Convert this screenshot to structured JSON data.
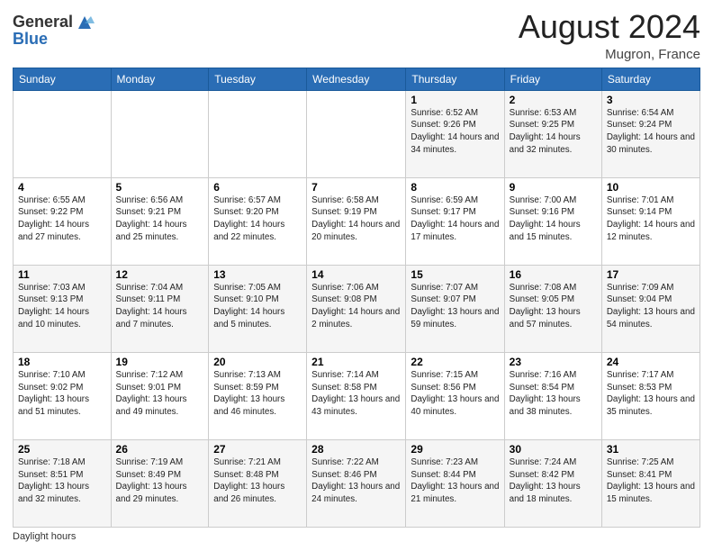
{
  "header": {
    "logo_general": "General",
    "logo_blue": "Blue",
    "month_year": "August 2024",
    "location": "Mugron, France"
  },
  "footer": {
    "daylight_label": "Daylight hours"
  },
  "days_of_week": [
    "Sunday",
    "Monday",
    "Tuesday",
    "Wednesday",
    "Thursday",
    "Friday",
    "Saturday"
  ],
  "weeks": [
    [
      {
        "day": "",
        "info": ""
      },
      {
        "day": "",
        "info": ""
      },
      {
        "day": "",
        "info": ""
      },
      {
        "day": "",
        "info": ""
      },
      {
        "day": "1",
        "info": "Sunrise: 6:52 AM\nSunset: 9:26 PM\nDaylight: 14 hours and 34 minutes."
      },
      {
        "day": "2",
        "info": "Sunrise: 6:53 AM\nSunset: 9:25 PM\nDaylight: 14 hours and 32 minutes."
      },
      {
        "day": "3",
        "info": "Sunrise: 6:54 AM\nSunset: 9:24 PM\nDaylight: 14 hours and 30 minutes."
      }
    ],
    [
      {
        "day": "4",
        "info": "Sunrise: 6:55 AM\nSunset: 9:22 PM\nDaylight: 14 hours and 27 minutes."
      },
      {
        "day": "5",
        "info": "Sunrise: 6:56 AM\nSunset: 9:21 PM\nDaylight: 14 hours and 25 minutes."
      },
      {
        "day": "6",
        "info": "Sunrise: 6:57 AM\nSunset: 9:20 PM\nDaylight: 14 hours and 22 minutes."
      },
      {
        "day": "7",
        "info": "Sunrise: 6:58 AM\nSunset: 9:19 PM\nDaylight: 14 hours and 20 minutes."
      },
      {
        "day": "8",
        "info": "Sunrise: 6:59 AM\nSunset: 9:17 PM\nDaylight: 14 hours and 17 minutes."
      },
      {
        "day": "9",
        "info": "Sunrise: 7:00 AM\nSunset: 9:16 PM\nDaylight: 14 hours and 15 minutes."
      },
      {
        "day": "10",
        "info": "Sunrise: 7:01 AM\nSunset: 9:14 PM\nDaylight: 14 hours and 12 minutes."
      }
    ],
    [
      {
        "day": "11",
        "info": "Sunrise: 7:03 AM\nSunset: 9:13 PM\nDaylight: 14 hours and 10 minutes."
      },
      {
        "day": "12",
        "info": "Sunrise: 7:04 AM\nSunset: 9:11 PM\nDaylight: 14 hours and 7 minutes."
      },
      {
        "day": "13",
        "info": "Sunrise: 7:05 AM\nSunset: 9:10 PM\nDaylight: 14 hours and 5 minutes."
      },
      {
        "day": "14",
        "info": "Sunrise: 7:06 AM\nSunset: 9:08 PM\nDaylight: 14 hours and 2 minutes."
      },
      {
        "day": "15",
        "info": "Sunrise: 7:07 AM\nSunset: 9:07 PM\nDaylight: 13 hours and 59 minutes."
      },
      {
        "day": "16",
        "info": "Sunrise: 7:08 AM\nSunset: 9:05 PM\nDaylight: 13 hours and 57 minutes."
      },
      {
        "day": "17",
        "info": "Sunrise: 7:09 AM\nSunset: 9:04 PM\nDaylight: 13 hours and 54 minutes."
      }
    ],
    [
      {
        "day": "18",
        "info": "Sunrise: 7:10 AM\nSunset: 9:02 PM\nDaylight: 13 hours and 51 minutes."
      },
      {
        "day": "19",
        "info": "Sunrise: 7:12 AM\nSunset: 9:01 PM\nDaylight: 13 hours and 49 minutes."
      },
      {
        "day": "20",
        "info": "Sunrise: 7:13 AM\nSunset: 8:59 PM\nDaylight: 13 hours and 46 minutes."
      },
      {
        "day": "21",
        "info": "Sunrise: 7:14 AM\nSunset: 8:58 PM\nDaylight: 13 hours and 43 minutes."
      },
      {
        "day": "22",
        "info": "Sunrise: 7:15 AM\nSunset: 8:56 PM\nDaylight: 13 hours and 40 minutes."
      },
      {
        "day": "23",
        "info": "Sunrise: 7:16 AM\nSunset: 8:54 PM\nDaylight: 13 hours and 38 minutes."
      },
      {
        "day": "24",
        "info": "Sunrise: 7:17 AM\nSunset: 8:53 PM\nDaylight: 13 hours and 35 minutes."
      }
    ],
    [
      {
        "day": "25",
        "info": "Sunrise: 7:18 AM\nSunset: 8:51 PM\nDaylight: 13 hours and 32 minutes."
      },
      {
        "day": "26",
        "info": "Sunrise: 7:19 AM\nSunset: 8:49 PM\nDaylight: 13 hours and 29 minutes."
      },
      {
        "day": "27",
        "info": "Sunrise: 7:21 AM\nSunset: 8:48 PM\nDaylight: 13 hours and 26 minutes."
      },
      {
        "day": "28",
        "info": "Sunrise: 7:22 AM\nSunset: 8:46 PM\nDaylight: 13 hours and 24 minutes."
      },
      {
        "day": "29",
        "info": "Sunrise: 7:23 AM\nSunset: 8:44 PM\nDaylight: 13 hours and 21 minutes."
      },
      {
        "day": "30",
        "info": "Sunrise: 7:24 AM\nSunset: 8:42 PM\nDaylight: 13 hours and 18 minutes."
      },
      {
        "day": "31",
        "info": "Sunrise: 7:25 AM\nSunset: 8:41 PM\nDaylight: 13 hours and 15 minutes."
      }
    ]
  ]
}
